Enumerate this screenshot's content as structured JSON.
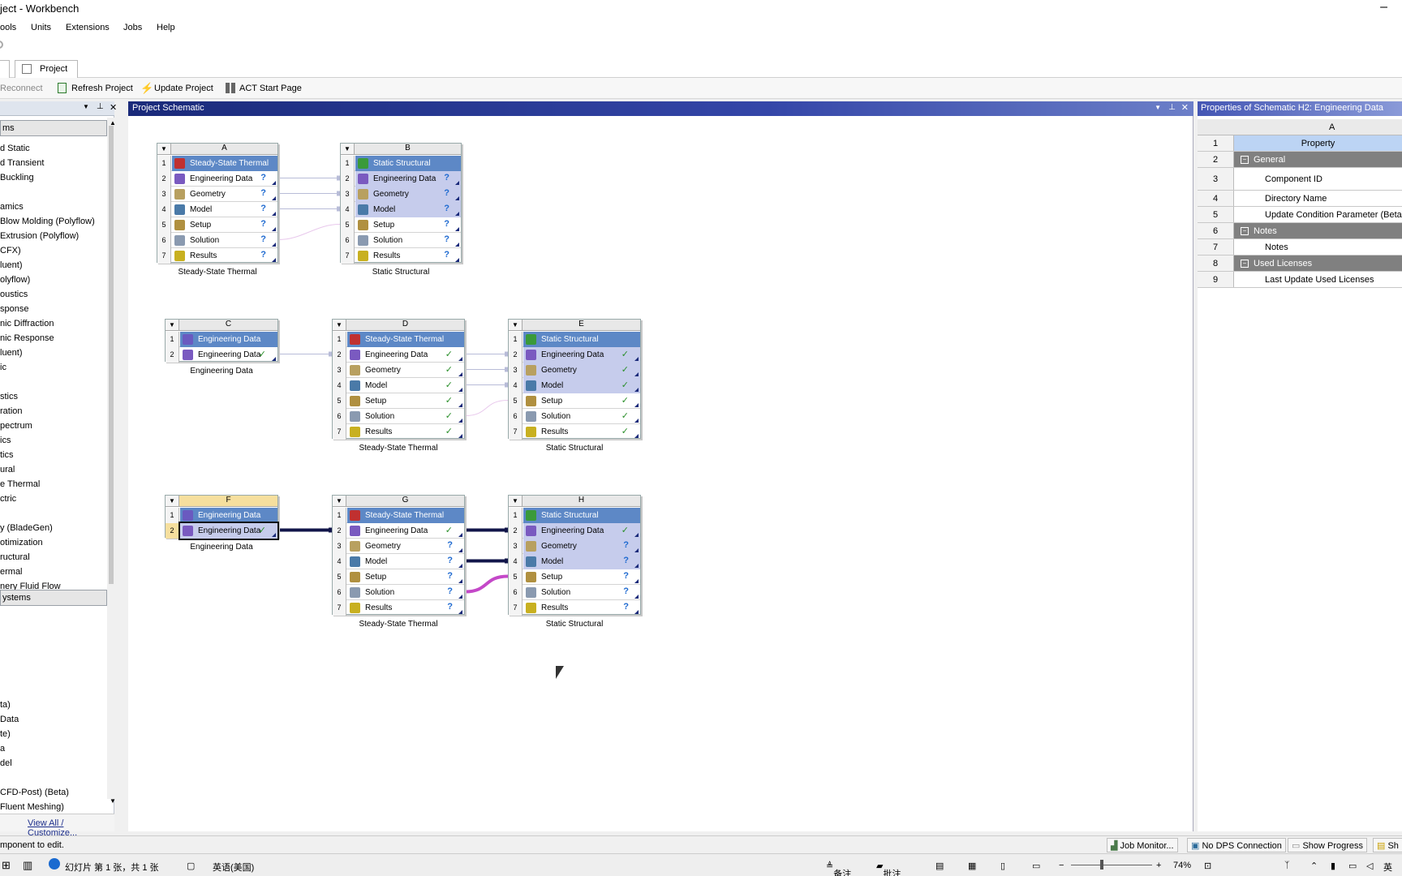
{
  "window": {
    "title": "ject - Workbench",
    "close": "–"
  },
  "menu": [
    "ools",
    "Units",
    "Extensions",
    "Jobs",
    "Help"
  ],
  "tabs": {
    "left": "",
    "project": "Project"
  },
  "toolbar": {
    "reconnect": "Reconnect",
    "refresh": "Refresh Project",
    "update": "Update Project",
    "act": "ACT Start Page"
  },
  "toolbox": {
    "group1": "ms",
    "items": [
      "d Static",
      "d Transient",
      "Buckling",
      "",
      "amics",
      "Blow Molding (Polyflow)",
      "Extrusion (Polyflow)",
      "CFX)",
      "luent)",
      "olyflow)",
      "oustics",
      "sponse",
      "nic Diffraction",
      "nic Response",
      "luent)",
      "ic",
      "",
      "stics",
      "ration",
      "pectrum",
      "ics",
      "tics",
      "ural",
      "e Thermal",
      "ctric",
      "",
      "y (BladeGen)",
      "otimization",
      "ructural",
      "ermal",
      "nery Fluid Flow"
    ],
    "group2": "ystems",
    "items2": [
      "ta)",
      "Data",
      "te)",
      "a",
      "del",
      "",
      "CFD-Post) (Beta)",
      "Fluent Meshing)"
    ],
    "view_all": "View All / Customize..."
  },
  "schematic": {
    "title": "Project Schematic"
  },
  "systems": [
    {
      "id": "A",
      "title": "Steady-State Thermal",
      "caption": "Steady-State Thermal",
      "rows": [
        [
          "Engineering Data",
          "?"
        ],
        [
          "Geometry",
          "?"
        ],
        [
          "Model",
          "?"
        ],
        [
          "Setup",
          "?"
        ],
        [
          "Solution",
          "?"
        ],
        [
          "Results",
          "?"
        ]
      ]
    },
    {
      "id": "B",
      "title": "Static Structural",
      "caption": "Static Structural",
      "rows": [
        [
          "Engineering Data",
          "?"
        ],
        [
          "Geometry",
          "?"
        ],
        [
          "Model",
          "?"
        ],
        [
          "Setup",
          "?"
        ],
        [
          "Solution",
          "?"
        ],
        [
          "Results",
          "?"
        ]
      ]
    },
    {
      "id": "C",
      "title": "Engineering Data",
      "caption": "Engineering Data",
      "rows": [
        [
          "Engineering Data",
          "✓"
        ]
      ]
    },
    {
      "id": "D",
      "title": "Steady-State Thermal",
      "caption": "Steady-State Thermal",
      "rows": [
        [
          "Engineering Data",
          "✓"
        ],
        [
          "Geometry",
          "✓"
        ],
        [
          "Model",
          "✓"
        ],
        [
          "Setup",
          "✓"
        ],
        [
          "Solution",
          "✓"
        ],
        [
          "Results",
          "✓"
        ]
      ]
    },
    {
      "id": "E",
      "title": "Static Structural",
      "caption": "Static Structural",
      "rows": [
        [
          "Engineering Data",
          "✓"
        ],
        [
          "Geometry",
          "✓"
        ],
        [
          "Model",
          "✓"
        ],
        [
          "Setup",
          "✓"
        ],
        [
          "Solution",
          "✓"
        ],
        [
          "Results",
          "✓"
        ]
      ]
    },
    {
      "id": "F",
      "title": "Engineering Data",
      "caption": "Engineering Data",
      "rows": [
        [
          "Engineering Data",
          "✓"
        ]
      ]
    },
    {
      "id": "G",
      "title": "Steady-State Thermal",
      "caption": "Steady-State Thermal",
      "rows": [
        [
          "Engineering Data",
          "✓"
        ],
        [
          "Geometry",
          "?"
        ],
        [
          "Model",
          "?"
        ],
        [
          "Setup",
          "?"
        ],
        [
          "Solution",
          "?"
        ],
        [
          "Results",
          "?"
        ]
      ]
    },
    {
      "id": "H",
      "title": "Static Structural",
      "caption": "Static Structural",
      "rows": [
        [
          "Engineering Data",
          "✓"
        ],
        [
          "Geometry",
          "?"
        ],
        [
          "Model",
          "?"
        ],
        [
          "Setup",
          "?"
        ],
        [
          "Solution",
          "?"
        ],
        [
          "Results",
          "?"
        ]
      ]
    }
  ],
  "properties": {
    "title": "Properties of Schematic H2: Engineering Data",
    "col": "A",
    "rows": [
      {
        "n": "1",
        "text": "Property",
        "type": "head"
      },
      {
        "n": "2",
        "text": "General",
        "type": "group"
      },
      {
        "n": "3",
        "text": "Component ID",
        "type": "item"
      },
      {
        "n": "4",
        "text": "Directory Name",
        "type": "item"
      },
      {
        "n": "5",
        "text": "Update Condition Parameter (Beta)",
        "type": "item"
      },
      {
        "n": "6",
        "text": "Notes",
        "type": "group"
      },
      {
        "n": "7",
        "text": "Notes",
        "type": "item"
      },
      {
        "n": "8",
        "text": "Used Licenses",
        "type": "group"
      },
      {
        "n": "9",
        "text": "Last Update Used Licenses",
        "type": "item"
      }
    ]
  },
  "status": {
    "text": "mponent to edit.",
    "job": "Job Monitor...",
    "dps": "No DPS Connection",
    "progress": "Show Progress",
    "sh": "Sh"
  },
  "taskbar": {
    "slide": "幻灯片 第 1 张，共 1 张",
    "lang": "英语(美国)",
    "notes": "备注",
    "comments": "批注",
    "zoom": "74%",
    "ime": "英"
  }
}
